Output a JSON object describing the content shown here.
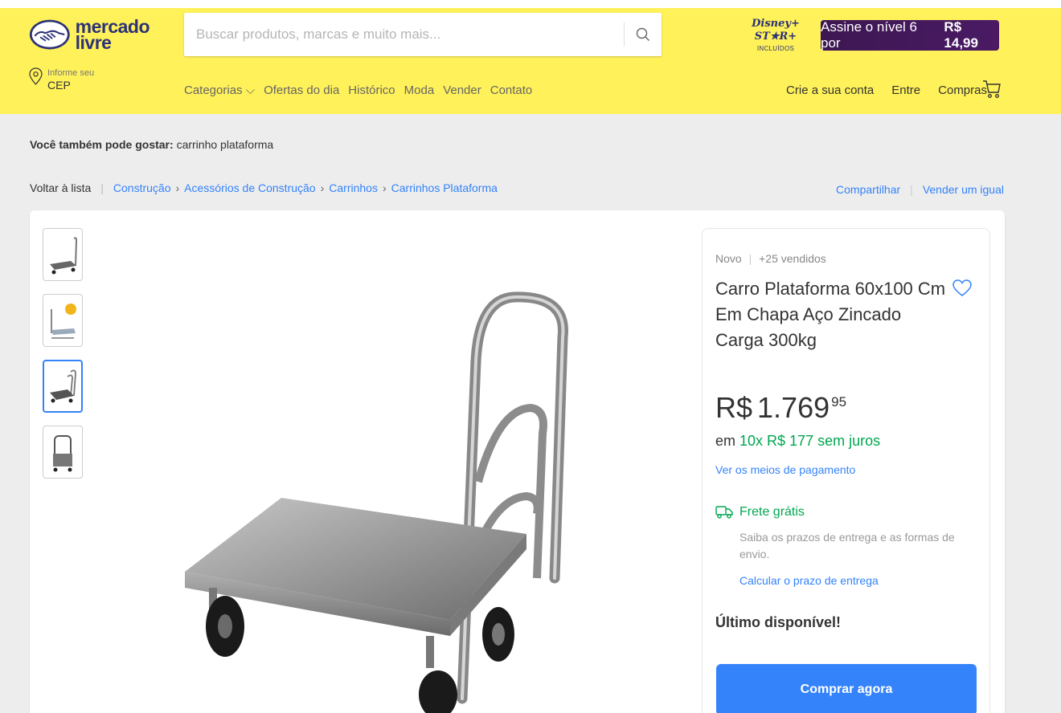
{
  "header": {
    "logo": {
      "line1": "mercado",
      "line2": "livre"
    },
    "search": {
      "placeholder": "Buscar produtos, marcas e muito mais..."
    },
    "promo": {
      "partner": "Disney+ ST★R+",
      "partner_sub": "INCLUÍDOS",
      "cta_prefix": "Assine o nível 6 por",
      "cta_price": "R$ 14,99"
    },
    "cep": {
      "small": "Informe seu",
      "big": "CEP"
    },
    "nav": [
      {
        "label": "Categorias ⌵"
      },
      {
        "label": "Ofertas do dia"
      },
      {
        "label": "Histórico"
      },
      {
        "label": "Moda"
      },
      {
        "label": "Vender"
      },
      {
        "label": "Contato"
      }
    ],
    "account": {
      "create": "Crie a sua conta",
      "login": "Entre",
      "purchases": "Compras"
    }
  },
  "suggest": {
    "label": "Você também pode gostar:",
    "term": "carrinho plataforma"
  },
  "breadcrumb": {
    "back": "Voltar à lista",
    "items": [
      "Construção",
      "Acessórios de Construção",
      "Carrinhos",
      "Carrinhos Plataforma"
    ],
    "share": "Compartilhar",
    "sell_same": "Vender um igual"
  },
  "product": {
    "condition": "Novo",
    "sold": "+25 vendidos",
    "title": "Carro Plataforma 60x100 Cm Em Chapa Aço Zincado Carga 300kg",
    "price_currency": "R$",
    "price_int": "1.769",
    "price_cents": "95",
    "install_prefix": "em",
    "install_value": "10x R$ 177 sem juros",
    "pay_link": "Ver os meios de pagamento",
    "shipping_label": "Frete grátis",
    "shipping_desc": "Saiba os prazos de entrega e as formas de envio.",
    "shipping_link": "Calcular o prazo de entrega",
    "stock": "Último disponível!",
    "buy_label": "Comprar agora",
    "thumbnails": 4,
    "selected_thumbnail": 3
  },
  "colors": {
    "header_bg": "#fff159",
    "link": "#3483fa",
    "green": "#00a650",
    "promo_bg": "#3d1752"
  }
}
